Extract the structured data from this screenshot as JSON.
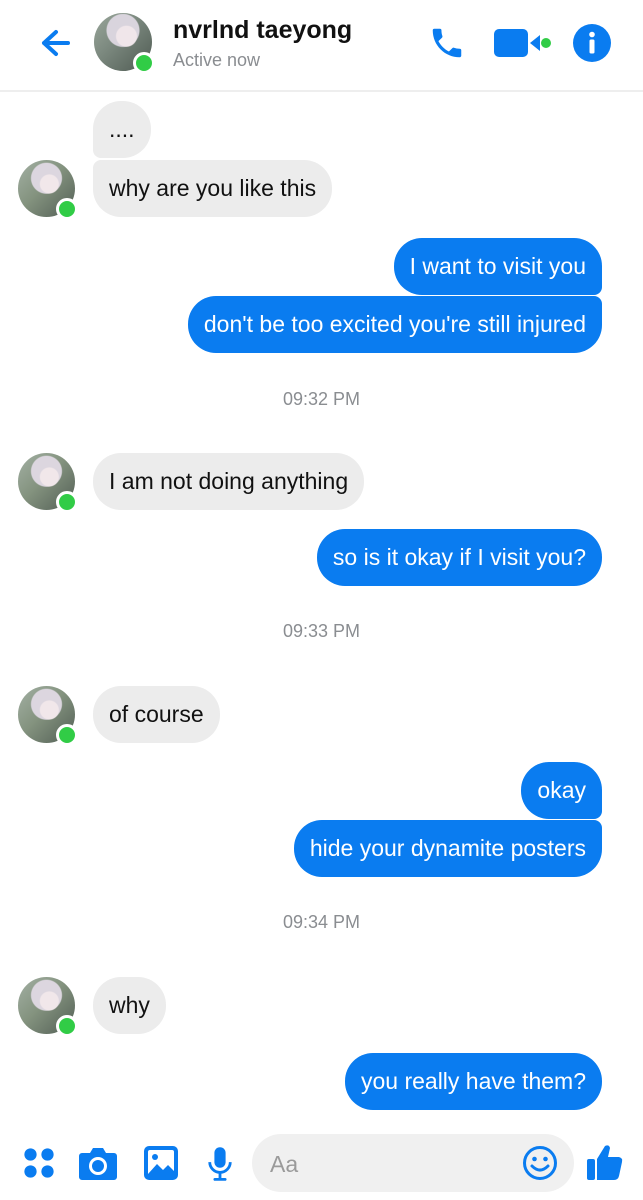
{
  "header": {
    "contact_name": "nvrlnd taeyong",
    "status": "Active now",
    "accent_color": "#0a7cf0",
    "icons": [
      "back-arrow-icon",
      "phone-icon",
      "video-camera-icon",
      "info-icon"
    ]
  },
  "messages": [
    {
      "from": "contact",
      "text": "...."
    },
    {
      "from": "contact",
      "text": "why are you like this"
    },
    {
      "from": "me",
      "text": "I want to visit you"
    },
    {
      "from": "me",
      "text": "don't be too excited you're still injured"
    },
    {
      "time": "09:32 PM"
    },
    {
      "from": "contact",
      "text": "I am not doing anything"
    },
    {
      "from": "me",
      "text": "so is it okay if I visit you?"
    },
    {
      "time": "09:33 PM"
    },
    {
      "from": "contact",
      "text": "of course"
    },
    {
      "from": "me",
      "text": "okay"
    },
    {
      "from": "me",
      "text": "hide your dynamite posters"
    },
    {
      "time": "09:34 PM"
    },
    {
      "from": "contact",
      "text": "why"
    },
    {
      "from": "me",
      "text": "you really have them?"
    }
  ],
  "composer": {
    "placeholder": "Aa",
    "icons": [
      "apps-icon",
      "camera-icon",
      "gallery-icon",
      "microphone-icon",
      "emoji-icon",
      "thumbs-up-icon"
    ]
  },
  "colors": {
    "outgoing_bubble": "#0a7cf0",
    "incoming_bubble": "#ececec",
    "online_dot": "#31cc46"
  }
}
